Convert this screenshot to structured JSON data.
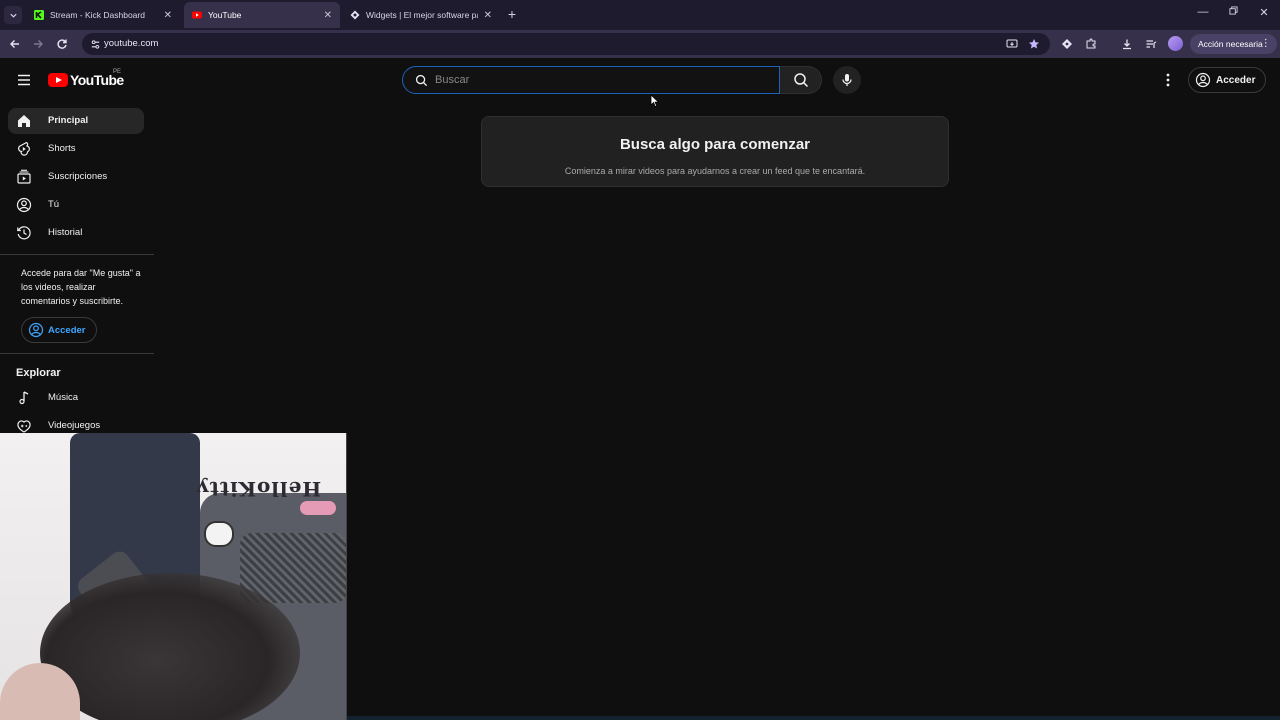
{
  "browser": {
    "tabs": [
      {
        "title": "Stream - Kick Dashboard",
        "favicon": "kick-icon"
      },
      {
        "title": "YouTube",
        "favicon": "youtube-icon",
        "active": true
      },
      {
        "title": "Widgets | El mejor software pa",
        "favicon": "widgets-icon"
      }
    ],
    "new_tab": "+",
    "url": "youtube.com",
    "profile_action": "Acción necesaria"
  },
  "youtube": {
    "logo_text": "YouTube",
    "country_code": "PE",
    "search": {
      "placeholder": "Buscar",
      "value": ""
    },
    "signin_label": "Acceder",
    "sidebar": {
      "items": [
        {
          "label": "Principal",
          "icon": "home-icon",
          "active": true
        },
        {
          "label": "Shorts",
          "icon": "shorts-icon"
        },
        {
          "label": "Suscripciones",
          "icon": "subscriptions-icon"
        },
        {
          "label": "Tú",
          "icon": "you-icon"
        },
        {
          "label": "Historial",
          "icon": "history-icon"
        }
      ],
      "signin_prompt": "Accede para dar \"Me gusta\" a los videos, realizar comentarios y suscribirte.",
      "signin_button": "Acceder",
      "explore_title": "Explorar",
      "explore_items": [
        {
          "label": "Música",
          "icon": "music-icon"
        },
        {
          "label": "Videojuegos",
          "icon": "gaming-icon"
        }
      ]
    },
    "empty_state": {
      "heading": "Busca algo para comenzar",
      "body": "Comienza a mirar videos para ayudarnos a crear un feed que te encantará."
    }
  },
  "webcam": {
    "sticker_text": "HelloKitty"
  },
  "colors": {
    "background": "#0f0f0f",
    "brand_red": "#ff0000",
    "link_blue": "#3ea6ff",
    "tab_strip": "#1f1b2e",
    "toolbar": "#36304a"
  }
}
